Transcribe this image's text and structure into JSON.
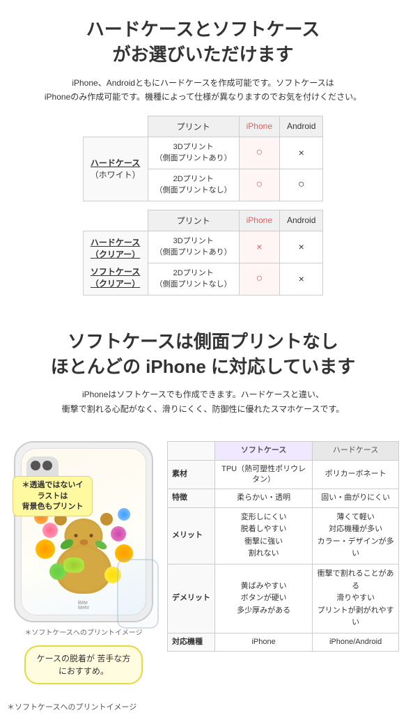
{
  "section1": {
    "title": "ハードケースとソフトケース\nがお選びいただけます",
    "description": "iPhone、Androidともにハードケースを作成可能です。ソフトケースは\niPhoneのみ作成可能です。機種によって仕様が異なりますのでお気を付けください。",
    "table1": {
      "col_print": "プリント",
      "col_iphone": "iPhone",
      "col_android": "Android",
      "section_hard_white": "ハードケース\n（ホワイト）",
      "row1_label": "3Dプリント\n（側面プリントあり）",
      "row1_iphone": "○",
      "row1_android": "×",
      "row2_label": "2Dプリント\n（側面プリントなし）",
      "row2_iphone": "○",
      "row2_android": "○",
      "section_hard_clear": "ハードケース\n（クリアー）",
      "section_soft_clear": "ソフトケース\n（クリアー）",
      "col2_print": "プリント",
      "col2_iphone": "iPhone",
      "col2_android": "Android",
      "row3_label": "3Dプリント\n（側面プリントあり）",
      "row3_iphone": "×",
      "row3_android": "×",
      "row4_label": "2Dプリント\n（側面プリントなし）",
      "row4_iphone": "○",
      "row4_android": "×"
    }
  },
  "section2": {
    "title": "ソフトケースは側面プリントなし\nほとんどの iPhone に対応しています",
    "description": "iPhoneはソフトケースでも作成できます。ハードケースと違い、\n衝撃で割れる心配がなく、滑りにくく、防御性に優れたスマホケースです。",
    "balloon_note": "＊透過ではないイラストは\n背景色もプリント",
    "phone_caption": "＊ソフトケースへのプリントイメージ",
    "case_balloon": "ケースの脱着が\n苦手な方におすすめ。",
    "comp_table": {
      "col_soft": "ソフトケース",
      "col_hard": "ハードケース",
      "row_material_label": "素材",
      "row_material_soft": "TPU（熱可塑性ポリウレタン）",
      "row_material_hard": "ポリカーボネート",
      "row_feature_label": "特徴",
      "row_feature_soft": "柔らかい・透明",
      "row_feature_hard": "固い・曲がりにくい",
      "row_merit_label": "メリット",
      "row_merit_soft": "変形しにくい\n脱着しやすい\n衝撃に強い\n割れない",
      "row_merit_hard": "薄くて軽い\n対応機種が多い\nカラー・デザインが多い",
      "row_demerit_label": "デメリット",
      "row_demerit_soft": "黄ばみやすい\nボタンが硬い\n多少厚みがある",
      "row_demerit_hard": "衝撃で割れることがある\n滑りやすい\nプリントが剥がれやすい",
      "row_compat_label": "対応機種",
      "row_compat_soft": "iPhone",
      "row_compat_hard": "iPhone/Android"
    }
  },
  "icons": {
    "circle_red": "○",
    "cross": "×",
    "circle_black": "○"
  },
  "colors": {
    "accent_red": "#e06060",
    "table_iphone_bg": "#fff5f5",
    "section_bg": "#ffffff",
    "soft_header_bg": "#f0e8ff",
    "balloon_bg": "#fffce0",
    "balloon_border": "#e8d840",
    "note_bg": "#fff9a0"
  }
}
